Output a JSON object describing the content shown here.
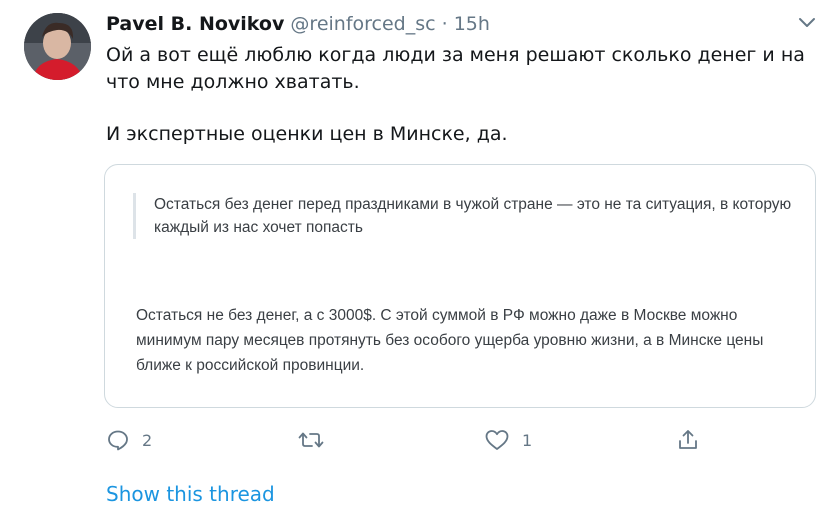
{
  "tweet": {
    "author_name": "Pavel B. Novikov",
    "handle": "@reinforced_sc",
    "separator": "·",
    "time": "15h",
    "text_lines": [
      "Ой а вот ещё люблю когда люди за меня решают сколько денег и на что мне должно хватать.",
      "И экспертные оценки цен в Минске, да."
    ]
  },
  "embedded_screenshot": {
    "quote": "Остаться без денег перед праздниками в чужой стране — это не та ситуация, в которую каждый из нас хочет попасть",
    "body": "Остаться не без денег, а с 3000$. С этой суммой в РФ можно даже в Москве можно минимум пару месяцев протянуть без особого ущерба уровню жизни, а в Минске цены ближе к российской провинции."
  },
  "actions": {
    "reply_count": "2",
    "retweet_count": "",
    "like_count": "1"
  },
  "show_thread_label": "Show this thread",
  "colors": {
    "text": "#14171a",
    "secondary": "#657786",
    "link": "#1b95e0",
    "border": "#cfd9de"
  },
  "icons": [
    "avatar-photo",
    "chevron-down-icon",
    "reply-icon",
    "retweet-icon",
    "like-icon",
    "share-icon"
  ]
}
